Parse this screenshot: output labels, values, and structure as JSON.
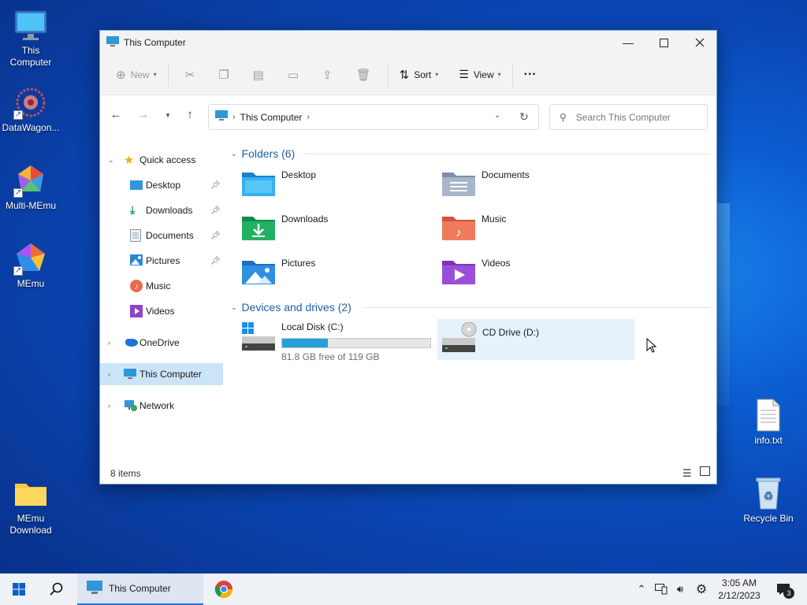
{
  "desktop": {
    "icons": [
      {
        "name": "this-computer",
        "label": "This\nComputer"
      },
      {
        "name": "datawagon",
        "label": "DataWagon..."
      },
      {
        "name": "multi-memu",
        "label": "Multi-MEmu"
      },
      {
        "name": "memu",
        "label": "MEmu"
      },
      {
        "name": "memu-download",
        "label": "MEmu\nDownload"
      },
      {
        "name": "info-txt",
        "label": "info.txt"
      },
      {
        "name": "recycle-bin",
        "label": "Recycle Bin"
      }
    ]
  },
  "window": {
    "title": "This Computer",
    "toolbar": {
      "new_label": "New",
      "sort_label": "Sort",
      "view_label": "View",
      "more_label": "···"
    },
    "address": {
      "crumb": "This Computer"
    },
    "search": {
      "placeholder": "Search This Computer"
    },
    "navpane": {
      "quick_access": "Quick access",
      "items": [
        "Desktop",
        "Downloads",
        "Documents",
        "Pictures",
        "Music",
        "Videos"
      ],
      "onedrive": "OneDrive",
      "this_computer": "This Computer",
      "network": "Network"
    },
    "folders_group": "Folders (6)",
    "folders": [
      "Desktop",
      "Documents",
      "Downloads",
      "Music",
      "Pictures",
      "Videos"
    ],
    "drives_group": "Devices and drives (2)",
    "drives": [
      {
        "name": "Local Disk (C:)",
        "free_text": "81.8 GB free of 119 GB",
        "used_fraction": 0.31
      },
      {
        "name": "CD Drive (D:)"
      }
    ],
    "status": "8 items"
  },
  "taskbar": {
    "app_label": "This Computer",
    "time": "3:05 AM",
    "date": "2/12/2023",
    "notification_count": "3"
  },
  "colors": {
    "accent": "#1d5fa8",
    "selection": "#cce4f7",
    "drive_bar": "#26a0da"
  }
}
